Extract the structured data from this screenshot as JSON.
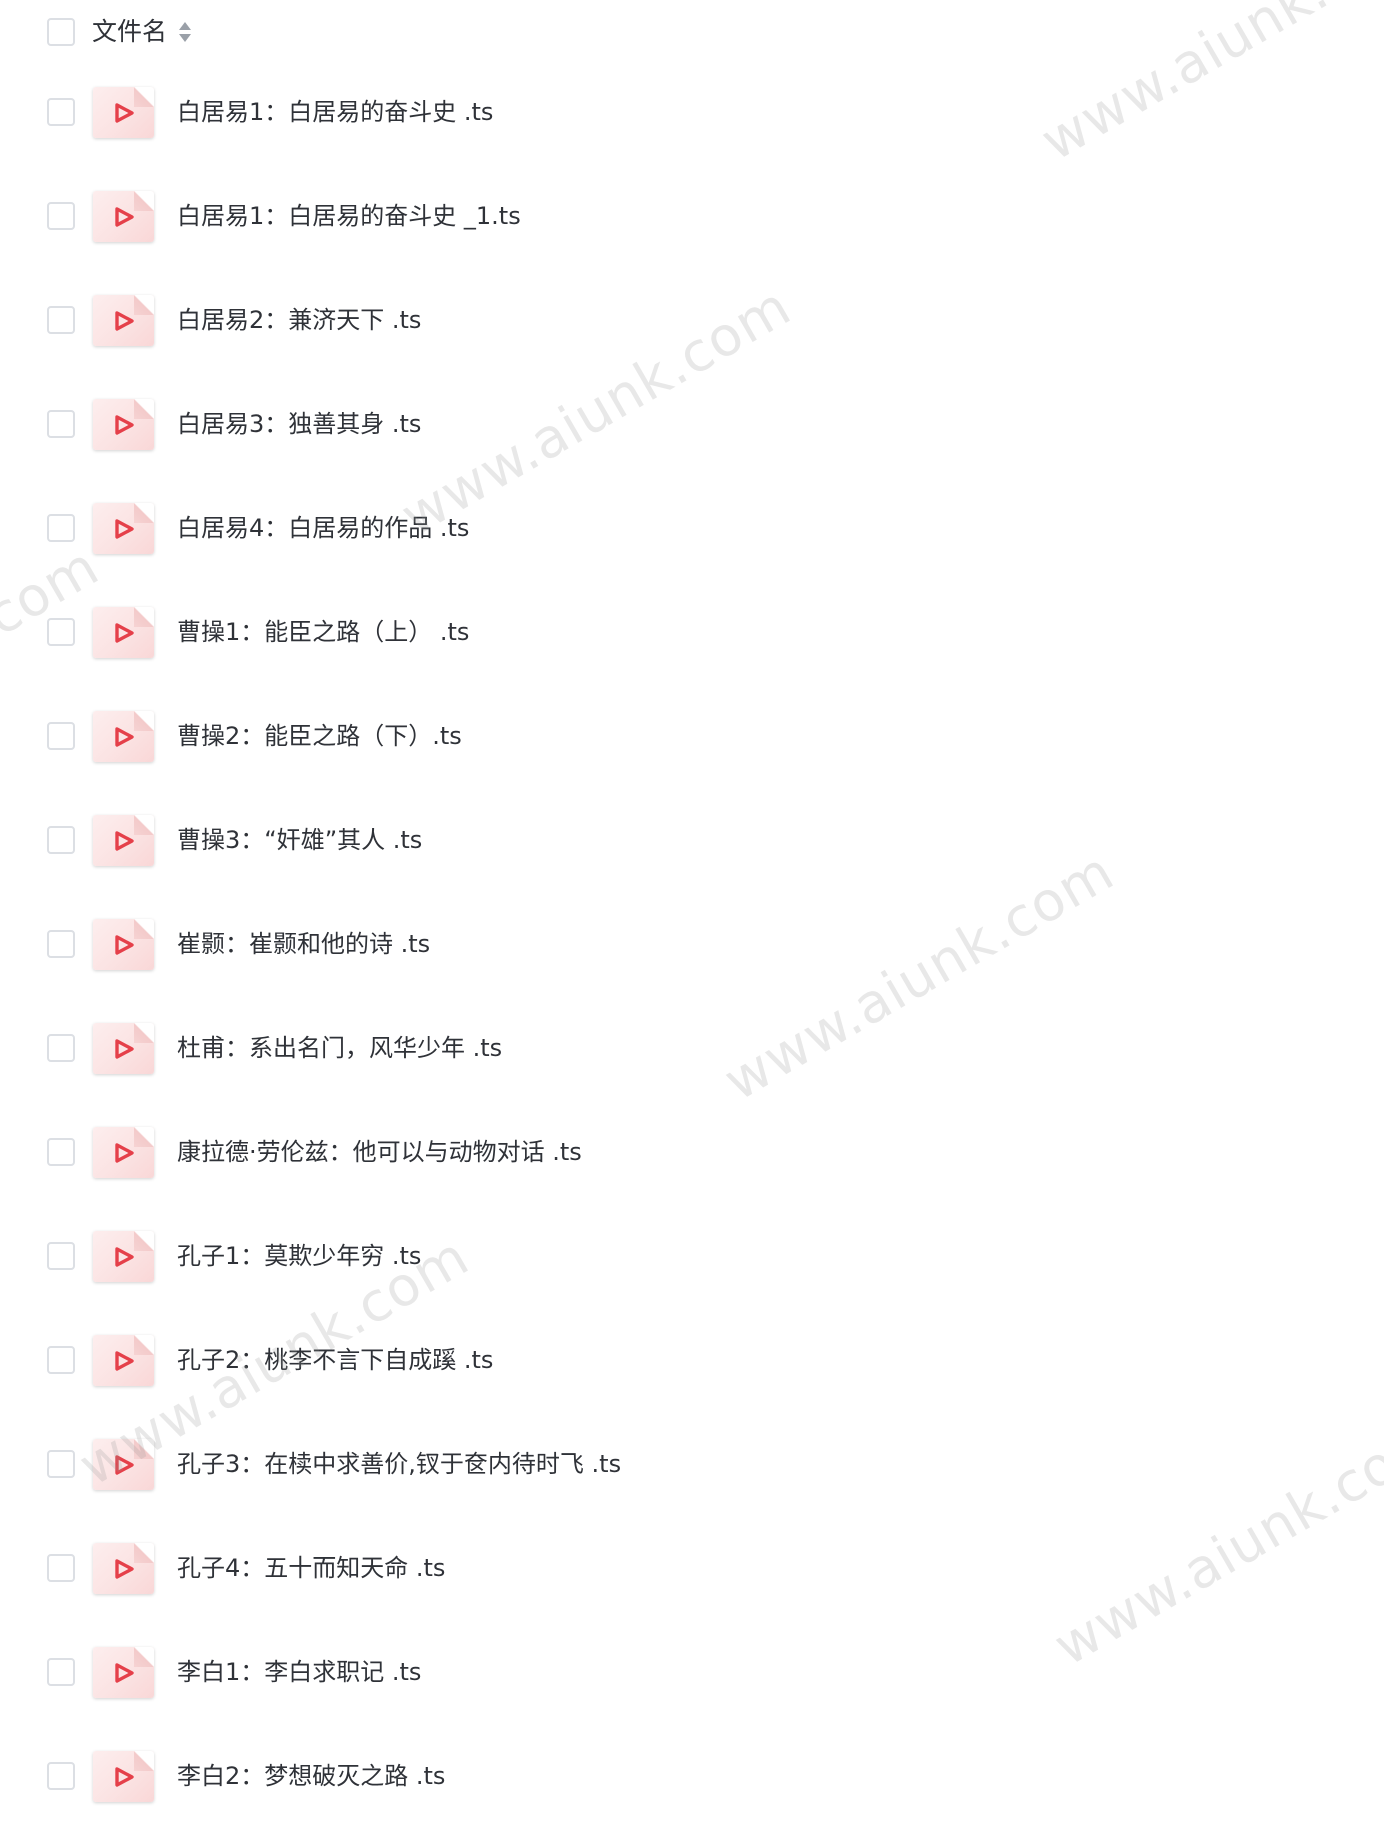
{
  "header": {
    "title": "文件名"
  },
  "files": [
    {
      "name": "白居易1：白居易的奋斗史 .ts"
    },
    {
      "name": "白居易1：白居易的奋斗史 _1.ts"
    },
    {
      "name": "白居易2：兼济天下 .ts"
    },
    {
      "name": "白居易3：独善其身 .ts"
    },
    {
      "name": "白居易4：白居易的作品 .ts"
    },
    {
      "name": "曹操1：能臣之路（上） .ts"
    },
    {
      "name": "曹操2：能臣之路（下）.ts"
    },
    {
      "name": "曹操3：“奸雄”其人 .ts"
    },
    {
      "name": "崔颢：崔颢和他的诗 .ts"
    },
    {
      "name": "杜甫：系出名门，风华少年 .ts"
    },
    {
      "name": "康拉德·劳伦兹：他可以与动物对话 .ts"
    },
    {
      "name": "孔子1：莫欺少年穷 .ts"
    },
    {
      "name": "孔子2：桃李不言下自成蹊 .ts"
    },
    {
      "name": "孔子3：在椟中求善价,钗于奁内待时飞 .ts"
    },
    {
      "name": "孔子4：五十而知天命 .ts"
    },
    {
      "name": "李白1：李白求职记 .ts"
    },
    {
      "name": "李白2：梦想破灭之路 .ts"
    }
  ],
  "watermark": {
    "text": "www.aiunk.com"
  },
  "colors": {
    "accent": "#e5404a",
    "icon_bg": "#fbe3e3",
    "checkbox_border": "#dcdfe4",
    "text": "#2f3238"
  },
  "icons": {
    "file_type": "play-icon",
    "sort": "sort-icon"
  }
}
